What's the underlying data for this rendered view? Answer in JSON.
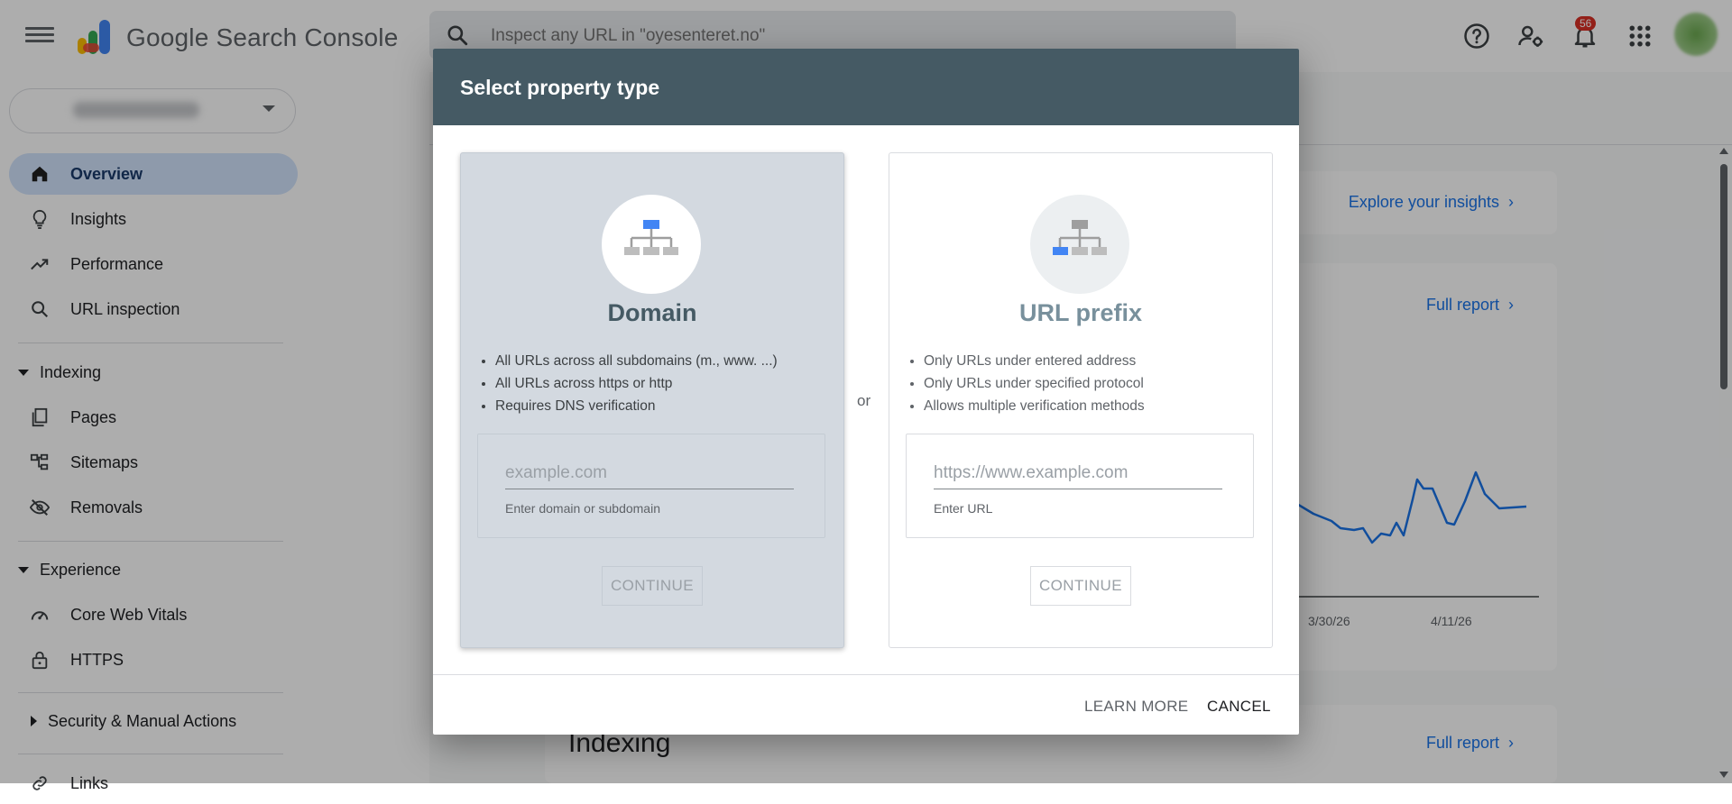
{
  "header": {
    "brand": "Google Search Console",
    "search_placeholder": "Inspect any URL in \"oyesenteret.no\"",
    "notification_count": "56"
  },
  "sidebar": {
    "items": [
      {
        "label": "Overview"
      },
      {
        "label": "Insights"
      },
      {
        "label": "Performance"
      },
      {
        "label": "URL inspection"
      }
    ],
    "sections": {
      "indexing": {
        "title": "Indexing",
        "items": [
          {
            "label": "Pages"
          },
          {
            "label": "Sitemaps"
          },
          {
            "label": "Removals"
          }
        ]
      },
      "experience": {
        "title": "Experience",
        "items": [
          {
            "label": "Core Web Vitals"
          },
          {
            "label": "HTTPS"
          }
        ]
      },
      "security": {
        "title": "Security & Manual Actions"
      },
      "links": {
        "title": "Links"
      }
    }
  },
  "main": {
    "explore_link": "Explore your insights",
    "full_report_1": "Full report",
    "full_report_2": "Full report",
    "indexing_title": "Indexing",
    "chart_ticks": [
      "3/30/26",
      "4/11/26"
    ]
  },
  "dialog": {
    "title": "Select property type",
    "or": "or",
    "domain": {
      "title": "Domain",
      "bullets": [
        "All URLs across all subdomains (m., www. ...)",
        "All URLs across https or http",
        "Requires DNS verification"
      ],
      "placeholder": "example.com",
      "help": "Enter domain or subdomain",
      "continue": "CONTINUE"
    },
    "url_prefix": {
      "title": "URL prefix",
      "bullets": [
        "Only URLs under entered address",
        "Only URLs under specified protocol",
        "Allows multiple verification methods"
      ],
      "placeholder": "https://www.example.com",
      "help": "Enter URL",
      "continue": "CONTINUE"
    },
    "footer": {
      "learn_more": "LEARN MORE",
      "cancel": "CANCEL"
    }
  },
  "colors": {
    "dialog_header": "#455a64",
    "accent_blue": "#1a73e8",
    "active_nav": "#d2e3fc",
    "selected_option": "#d3d9e0",
    "badge": "#d93025"
  }
}
